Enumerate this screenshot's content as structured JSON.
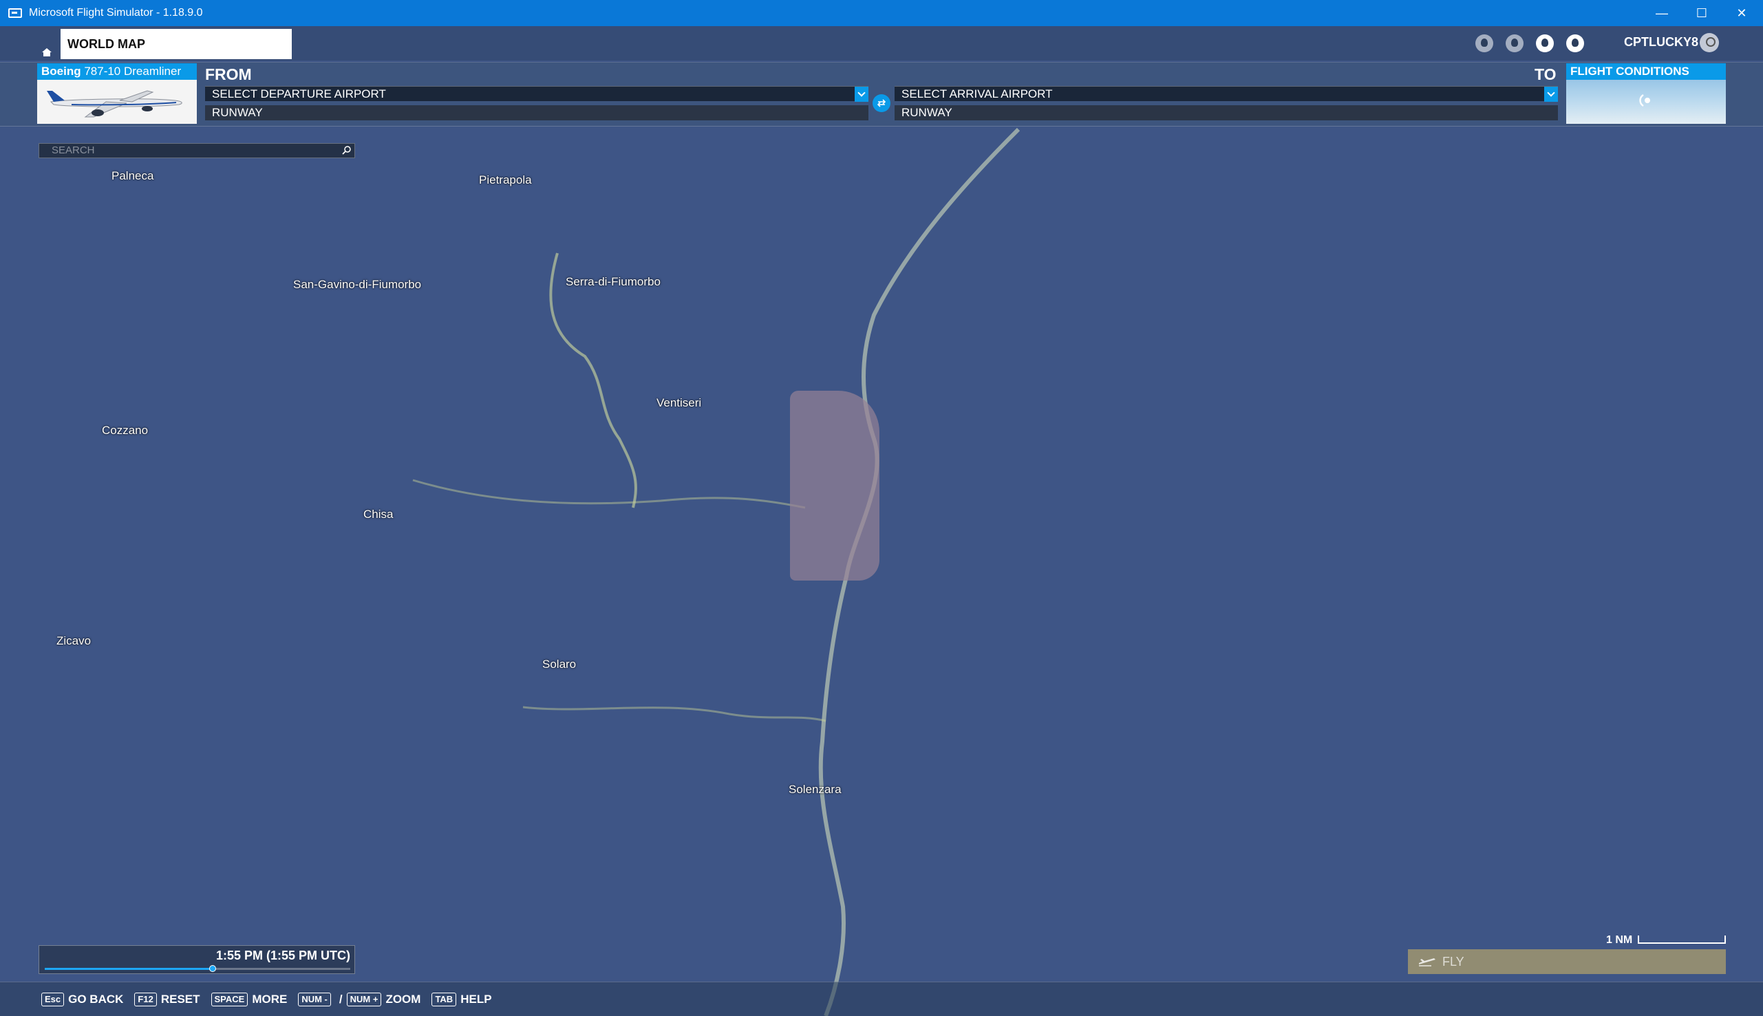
{
  "window": {
    "title": "Microsoft Flight Simulator - 1.18.9.0",
    "controls": {
      "minimize": "—",
      "maximize": "☐",
      "close": "✕"
    }
  },
  "header": {
    "breadcrumb": "WORLD MAP",
    "username": "CPTLUCKY8"
  },
  "aircraft": {
    "brand": "Boeing",
    "model": " 787-10 Dreamliner"
  },
  "flight_plan": {
    "from_label": "FROM",
    "to_label": "TO",
    "departure_placeholder": "SELECT DEPARTURE AIRPORT",
    "arrival_placeholder": "SELECT ARRIVAL AIRPORT",
    "departure_runway": "RUNWAY",
    "arrival_runway": "RUNWAY"
  },
  "conditions": {
    "title": "FLIGHT CONDITIONS"
  },
  "search": {
    "placeholder": "SEARCH"
  },
  "map": {
    "places": [
      "Palneca",
      "Pietrapola",
      "San-Gavino-di-Fiumorbo",
      "Serra-di-Fiumorbo",
      "Ventiseri",
      "Cozzano",
      "Chisa",
      "Zicavo",
      "Solaro",
      "Solenzara"
    ],
    "scale_label": "1 NM"
  },
  "time": {
    "label": "1:55 PM (1:55 PM UTC)",
    "progress_fraction": 0.55
  },
  "fly": {
    "label": "FLY"
  },
  "shortcuts": {
    "back": {
      "key": "Esc",
      "label": "GO BACK"
    },
    "reset": {
      "key": "F12",
      "label": "RESET"
    },
    "more": {
      "key": "SPACE",
      "label": "MORE"
    },
    "zoom": {
      "key_minus": "NUM -",
      "separator": "/",
      "key_plus": "NUM +",
      "label": "ZOOM"
    },
    "help": {
      "key": "TAB",
      "label": "HELP"
    }
  },
  "colors": {
    "accent": "#0a9ae8",
    "titlebar": "#0a78d7",
    "sea": "#3e5586"
  }
}
